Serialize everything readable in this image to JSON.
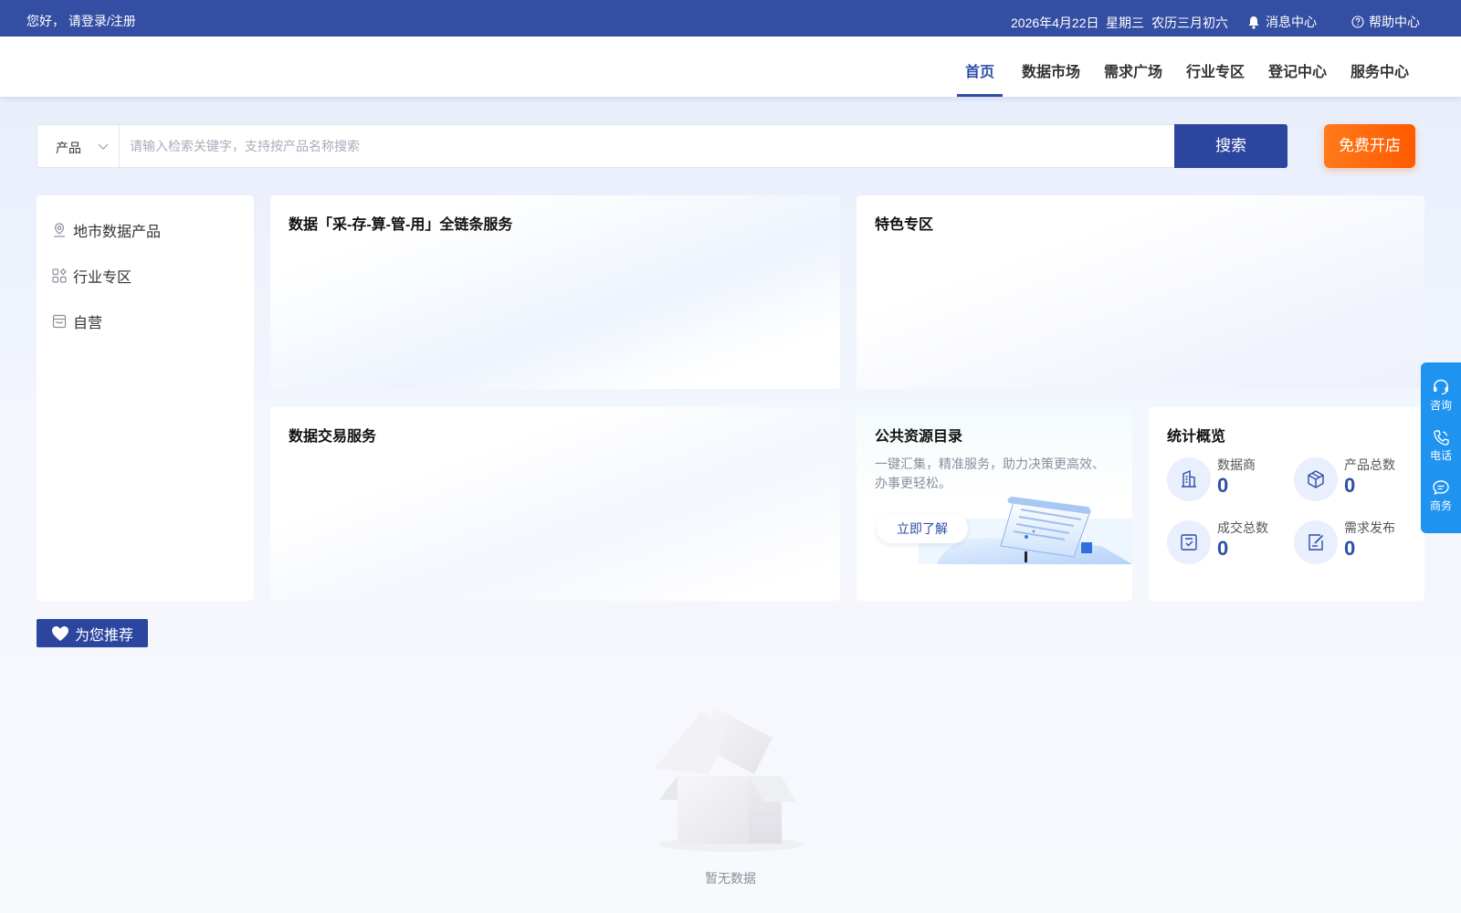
{
  "topbar": {
    "greeting": "您好， 请登录/注册",
    "date": "2026年4月22日",
    "weekday": "星期三",
    "lunar": "农历三月初六",
    "messages": "消息中心",
    "help": "帮助中心"
  },
  "nav": {
    "items": [
      "首页",
      "数据市场",
      "需求广场",
      "行业专区",
      "登记中心",
      "服务中心"
    ],
    "active": "首页"
  },
  "search": {
    "type": "产品",
    "placeholder": "请输入检索关键字，支持按产品名称搜索",
    "button": "搜索",
    "open_shop": "免费开店"
  },
  "sidemenu": {
    "items": [
      {
        "label": "地市数据产品",
        "icon": "location-icon"
      },
      {
        "label": "行业专区",
        "icon": "apps-icon"
      },
      {
        "label": "自营",
        "icon": "store-icon"
      }
    ]
  },
  "cards": {
    "chain_service": "数据「采-存-算-管-用」全链条服务",
    "featured": "特色专区",
    "trade_service": "数据交易服务",
    "public_catalog": {
      "title": "公共资源目录",
      "desc": "一键汇集，精准服务，助力决策更高效、办事更轻松。",
      "button": "立即了解"
    },
    "stats": {
      "title": "统计概览",
      "items": [
        {
          "label": "数据商",
          "value": "0",
          "icon": "building-icon"
        },
        {
          "label": "产品总数",
          "value": "0",
          "icon": "cube-icon"
        },
        {
          "label": "成交总数",
          "value": "0",
          "icon": "checklist-icon"
        },
        {
          "label": "需求发布",
          "value": "0",
          "icon": "edit-icon"
        }
      ]
    }
  },
  "recommend": {
    "label": "为您推荐",
    "empty": "暂无数据"
  },
  "floatbar": {
    "items": [
      {
        "label": "咨询",
        "icon": "headset-icon"
      },
      {
        "label": "电话",
        "icon": "phone-icon"
      },
      {
        "label": "商务",
        "icon": "chat-icon"
      }
    ]
  },
  "colors": {
    "primary": "#2c469f",
    "topbar": "#344ea3",
    "accent_orange": "#ff6a00",
    "float_blue": "#1e93f0"
  }
}
